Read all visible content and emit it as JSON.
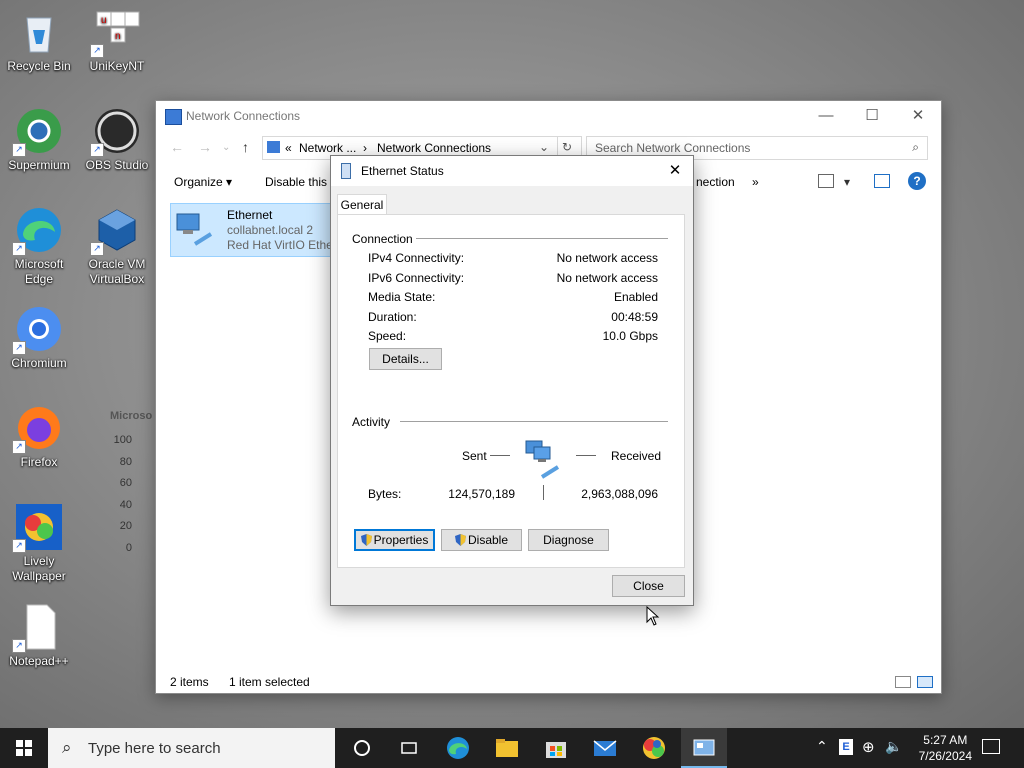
{
  "desktop": {
    "icons": [
      {
        "label": "Recycle Bin",
        "icon": "recycle-bin-icon"
      },
      {
        "label": "UniKeyNT",
        "icon": "unikey-icon"
      },
      {
        "label": "Supermium",
        "icon": "supermium-icon"
      },
      {
        "label": "OBS Studio",
        "icon": "obs-icon"
      },
      {
        "label": "Microsoft Edge",
        "icon": "edge-icon"
      },
      {
        "label": "Oracle VM VirtualBox",
        "icon": "virtualbox-icon"
      },
      {
        "label": "Chromium",
        "icon": "chromium-icon"
      },
      {
        "label": "Firefox",
        "icon": "firefox-icon"
      },
      {
        "label": "Lively Wallpaper",
        "icon": "lively-icon"
      },
      {
        "label": "Notepad++",
        "icon": "notepad-icon"
      }
    ],
    "bg_chart": {
      "title": "Microso",
      "ticks": [
        "100",
        "80",
        "60",
        "40",
        "20",
        "0"
      ],
      "top_tick": "60"
    }
  },
  "explorer": {
    "title": "Network Connections",
    "breadcrumb": {
      "prefix": "«",
      "part1": "Network ...",
      "sep": "›",
      "part2": "Network Connections"
    },
    "search_placeholder": "Search Network Connections",
    "toolbar": {
      "organize": "Organize ▾",
      "disable": "Disable this n",
      "connection": "nection",
      "more": "»"
    },
    "item": {
      "name": "Ethernet",
      "line2": "collabnet.local 2",
      "line3": "Red Hat VirtIO Ether"
    },
    "status": {
      "count": "2 items",
      "selected": "1 item selected"
    }
  },
  "dialog": {
    "title": "Ethernet Status",
    "tab": "General",
    "connection_heading": "Connection",
    "rows": [
      {
        "label": "IPv4 Connectivity:",
        "value": "No network access"
      },
      {
        "label": "IPv6 Connectivity:",
        "value": "No network access"
      },
      {
        "label": "Media State:",
        "value": "Enabled"
      },
      {
        "label": "Duration:",
        "value": "00:48:59"
      },
      {
        "label": "Speed:",
        "value": "10.0 Gbps"
      }
    ],
    "details_button": "Details...",
    "activity_heading": "Activity",
    "sent_label": "Sent",
    "received_label": "Received",
    "bytes_label": "Bytes:",
    "bytes_sent": "124,570,189",
    "bytes_received": "2,963,088,096",
    "properties_button": "Properties",
    "disable_button": "Disable",
    "diagnose_button": "Diagnose",
    "close_button": "Close"
  },
  "taskbar": {
    "search_placeholder": "Type here to search",
    "time": "5:27 AM",
    "date": "7/26/2024"
  },
  "colors": {
    "accent": "#0078d7",
    "selection": "#cce8ff",
    "taskbar": "#1f1f1f"
  }
}
